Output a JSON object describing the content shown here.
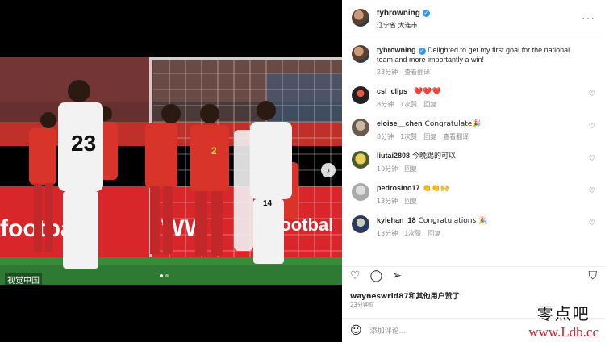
{
  "post": {
    "username": "tybrowning",
    "location": "辽宁省 大连市",
    "caption_user": "tybrowning",
    "caption": "Delighted to get my first goal for the national team and more importantly a win!",
    "caption_time": "23分钟",
    "caption_translate": "查看翻译",
    "photo_credit": "视觉中国",
    "likes_text": "wayneswrld87和其他用户赞了",
    "posted_ago": "23分钟前",
    "comment_placeholder": "添加评论..."
  },
  "comments": [
    {
      "user": "csl_clips_",
      "text": "❤️❤️❤️",
      "time": "8分钟",
      "likes": "1次赞",
      "reply": "回复",
      "translate": ""
    },
    {
      "user": "eloise__chen",
      "text": "Congratulate🎉",
      "time": "8分钟",
      "likes": "1次赞",
      "reply": "回复",
      "translate": "查看翻译"
    },
    {
      "user": "liutai2808",
      "text": "今晚踢的可以",
      "time": "10分钟",
      "likes": "",
      "reply": "回复",
      "translate": ""
    },
    {
      "user": "pedrosino17",
      "text": "👏👏🙌",
      "time": "13分钟",
      "likes": "",
      "reply": "回复",
      "translate": ""
    },
    {
      "user": "kylehan_18",
      "text": "Congratulations 🎉",
      "time": "13分钟",
      "likes": "1次赞",
      "reply": "回复",
      "translate": ""
    }
  ],
  "icons": {
    "more": "more-horizontal-icon",
    "like": "heart-icon",
    "comment": "comment-icon",
    "share": "send-icon",
    "save": "bookmark-icon",
    "emoji": "smile-icon",
    "next": "chevron-right-icon"
  },
  "photo": {
    "jersey_number_back": "23",
    "jersey_number_front_1": "2",
    "jersey_number_front_2": "14",
    "board_text": "footba",
    "board_text_2": "WW",
    "board_text_3": "footbal"
  },
  "site_watermark": {
    "cn": "零点吧",
    "url": "www.Ldb.cc"
  },
  "colors": {
    "verified": "#3897f0",
    "secondary_text": "#8e8e8e",
    "watermark_url": "#d0202c"
  }
}
